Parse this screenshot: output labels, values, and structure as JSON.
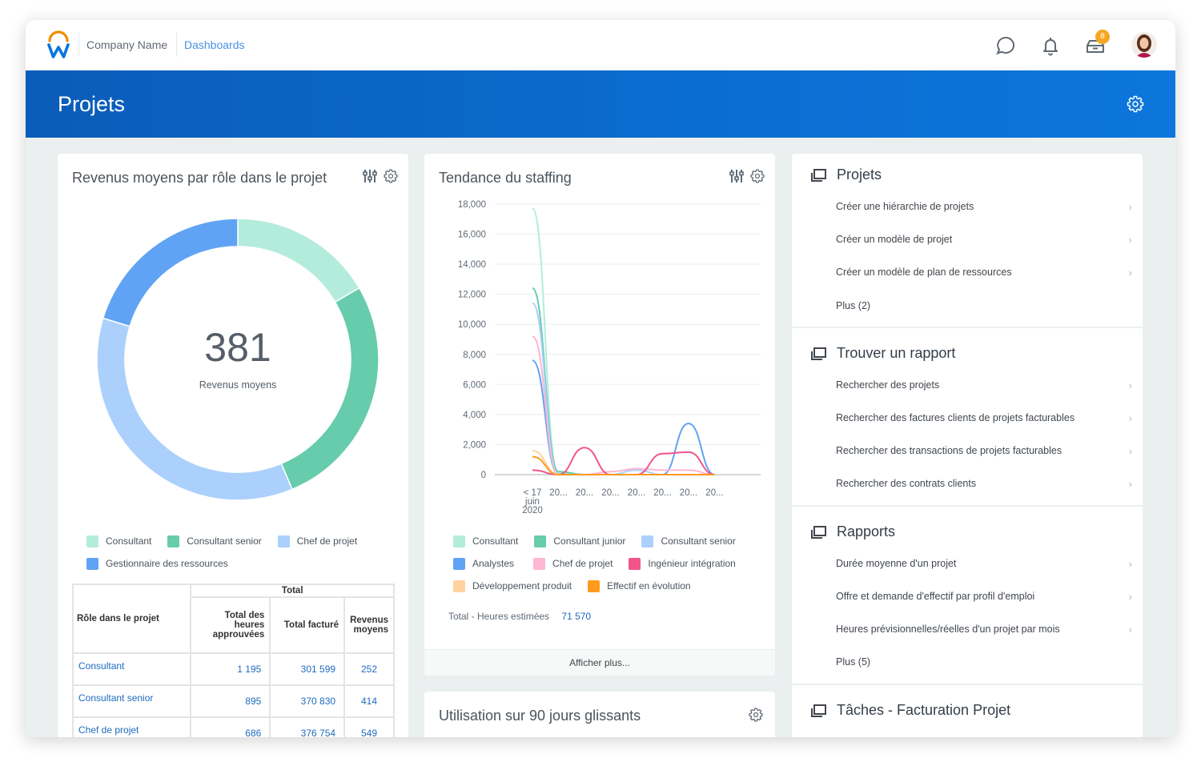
{
  "header": {
    "company_name": "Company Name",
    "breadcrumb": "Dashboards",
    "notification_badge": "8",
    "icons": [
      "chat-icon",
      "bell-icon",
      "inbox-icon",
      "avatar"
    ]
  },
  "banner": {
    "title": "Projets",
    "icon": "gear-icon"
  },
  "revenue_card": {
    "title": "Revenus moyens par rôle dans le projet",
    "center_value": "381",
    "center_label": "Revenus moyens",
    "legend": [
      {
        "label": "Consultant",
        "color": "#b4ecdc"
      },
      {
        "label": "Consultant senior",
        "color": "#66ccac"
      },
      {
        "label": "Chef de projet",
        "color": "#abd0fc"
      },
      {
        "label": "Gestionnaire des ressources",
        "color": "#60a3f5"
      }
    ],
    "table": {
      "group_header": "Total",
      "columns": [
        "Rôle dans le projet",
        "Total des heures approuvées",
        "Total facturé",
        "Revenus moyens"
      ],
      "rows": [
        [
          "Consultant",
          "1 195",
          "301 599",
          "252"
        ],
        [
          "Consultant senior",
          "895",
          "370 830",
          "414"
        ],
        [
          "Chef de projet",
          "686",
          "376 754",
          "549"
        ]
      ]
    }
  },
  "staffing_card": {
    "title": "Tendance du staffing",
    "total_label": "Total - Heures estimées",
    "total_value": "71 570",
    "show_more": "Afficher plus..."
  },
  "utilisation_card": {
    "title": "Utilisation sur 90 jours glissants"
  },
  "links": {
    "sections": [
      {
        "title": "Projets",
        "items": [
          "Créer une hiérarchie de projets",
          "Créer un modèle de projet",
          "Créer un modèle de plan de ressources"
        ],
        "more": "Plus (2)"
      },
      {
        "title": "Trouver un rapport",
        "items": [
          "Rechercher des projets",
          "Rechercher des factures clients de projets facturables",
          "Rechercher des transactions de projets facturables",
          "Rechercher des contrats clients"
        ],
        "more": ""
      },
      {
        "title": "Rapports",
        "items": [
          "Durée moyenne d'un projet",
          "Offre et demande d'effectif par profil d'emploi",
          "Heures prévisionnelles/réelles d'un projet par mois"
        ],
        "more": "Plus (5)"
      },
      {
        "title": "Tâches - Facturation Projet",
        "items": [],
        "more": ""
      }
    ]
  },
  "chart_data": [
    {
      "type": "pie",
      "title": "Revenus moyens par rôle dans le projet",
      "categories": [
        "Consultant",
        "Consultant senior",
        "Chef de projet",
        "Gestionnaire des ressources"
      ],
      "values": [
        252,
        414,
        549,
        309
      ],
      "colors": [
        "#b4ecdc",
        "#66ccac",
        "#abd0fc",
        "#60a3f5"
      ],
      "center_text": "381",
      "center_subtext": "Revenus moyens",
      "legend": "bottom"
    },
    {
      "type": "line",
      "title": "Tendance du staffing",
      "x": [
        "< 17 juin 2020",
        "20...",
        "20...",
        "20...",
        "20...",
        "20...",
        "20...",
        "20..."
      ],
      "yticks": [
        "0",
        "2,000",
        "4,000",
        "6,000",
        "8,000",
        "10,000",
        "12,000",
        "14,000",
        "16,000",
        "18,000"
      ],
      "ylim": [
        0,
        18000
      ],
      "grid": true,
      "legend": "bottom",
      "series": [
        {
          "name": "Consultant",
          "color": "#b4ecdc",
          "values": [
            17700,
            100,
            0,
            0,
            0,
            0,
            0,
            0
          ]
        },
        {
          "name": "Consultant junior",
          "color": "#66ccac",
          "values": [
            12400,
            200,
            0,
            0,
            0,
            0,
            0,
            0
          ]
        },
        {
          "name": "Consultant senior",
          "color": "#abd0fc",
          "values": [
            11400,
            0,
            0,
            0,
            300,
            0,
            0,
            0
          ]
        },
        {
          "name": "Analystes",
          "color": "#60a3f5",
          "values": [
            7600,
            0,
            0,
            0,
            0,
            0,
            3400,
            0
          ]
        },
        {
          "name": "Chef de projet",
          "color": "#ffb6d2",
          "values": [
            9200,
            0,
            0,
            200,
            400,
            300,
            300,
            0
          ]
        },
        {
          "name": "Ingénieur intégration",
          "color": "#f2558b",
          "values": [
            300,
            0,
            1800,
            0,
            0,
            1400,
            1500,
            0
          ]
        },
        {
          "name": "Développement produit",
          "color": "#ffd3a0",
          "values": [
            1600,
            0,
            0,
            0,
            0,
            0,
            0,
            0
          ]
        },
        {
          "name": "Effectif en évolution",
          "color": "#ff9a1f",
          "values": [
            1200,
            0,
            0,
            0,
            0,
            0,
            0,
            0
          ]
        }
      ]
    }
  ]
}
